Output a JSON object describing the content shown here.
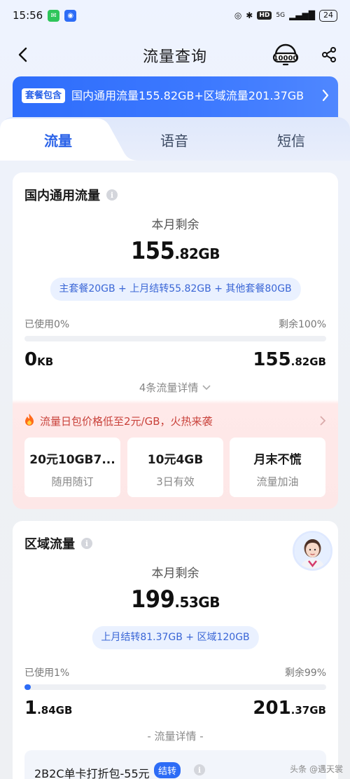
{
  "status_bar": {
    "time": "15:56",
    "network": "5G",
    "battery": "24",
    "hd": "HD"
  },
  "nav": {
    "title": "流量查询",
    "service_icon_text": "10000"
  },
  "banner": {
    "tag": "套餐包含",
    "text": "国内通用流量155.82GB+区域流量201.37GB"
  },
  "tabs": [
    {
      "label": "流量",
      "active": true
    },
    {
      "label": "语音",
      "active": false
    },
    {
      "label": "短信",
      "active": false
    }
  ],
  "domestic": {
    "title": "国内通用流量",
    "remaining_label": "本月剩余",
    "remaining_int": "155",
    "remaining_dec": ".82GB",
    "composition": "主套餐20GB + 上月结转55.82GB + 其他套餐80GB",
    "used_label": "已使用0%",
    "remain_label": "剩余100%",
    "used_fraction": 0,
    "used_int": "0",
    "used_unit": "KB",
    "total_int": "155",
    "total_dec": ".82GB",
    "details": "4条流量详情",
    "promo": "流量日包价格低至2元/GB，火热来袭",
    "offers": [
      {
        "title": "20元10GB7...",
        "sub": "随用随订"
      },
      {
        "title": "10元4GB",
        "sub": "3日有效"
      },
      {
        "title": "月末不慌",
        "sub": "流量加油"
      }
    ]
  },
  "regional": {
    "title": "区域流量",
    "remaining_label": "本月剩余",
    "remaining_int": "199",
    "remaining_dec": ".53GB",
    "composition": "上月结转81.37GB + 区域120GB",
    "used_label": "已使用1%",
    "remain_label": "剩余99%",
    "used_fraction": 0.01,
    "used_int": "1",
    "used_dec": ".84GB",
    "total_int": "201",
    "total_dec": ".37GB",
    "details": "- 流量详情 -",
    "package_label": "2B2C单卡打折包-55元",
    "package_badge": "结转"
  },
  "watermark": "头条 @遇天裳",
  "colors": {
    "accent": "#2d6cf6",
    "banner": "#3d79ff",
    "promo_red": "#c9423b"
  }
}
